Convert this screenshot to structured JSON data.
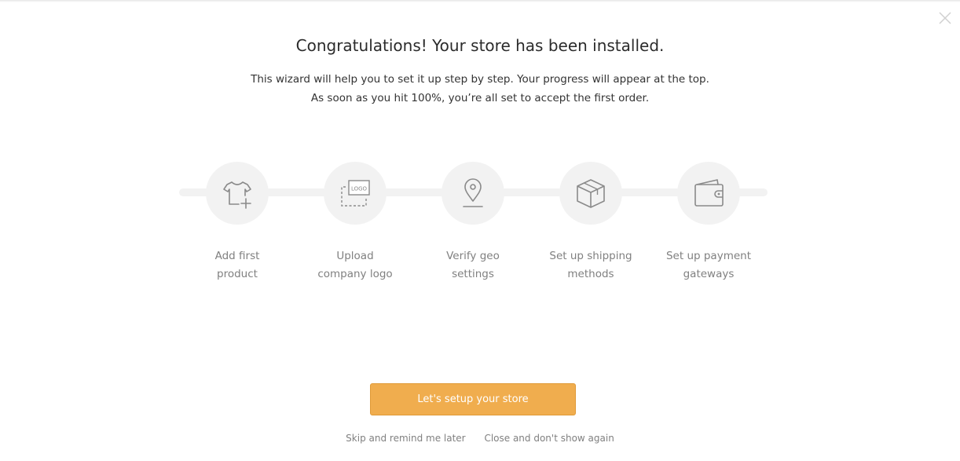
{
  "header": {
    "title": "Congratulations! Your store has been installed.",
    "subtitle_line1": "This wizard will help you to set it up step by step. Your progress will appear at the top.",
    "subtitle_line2": "As soon as you hit 100%, you’re all set to accept the first order."
  },
  "steps": [
    {
      "label": "Add first\nproduct",
      "icon": "tshirt-plus-icon"
    },
    {
      "label": "Upload\ncompany logo",
      "icon": "logo-upload-icon",
      "logo_text": "LOGO"
    },
    {
      "label": "Verify geo\nsettings",
      "icon": "map-pin-icon"
    },
    {
      "label": "Set up shipping\nmethods",
      "icon": "box-icon"
    },
    {
      "label": "Set up payment\ngateways",
      "icon": "wallet-icon"
    }
  ],
  "actions": {
    "primary_label": "Let's setup your store",
    "skip_label": "Skip and remind me later",
    "dismiss_label": "Close and don't show again"
  },
  "colors": {
    "accent": "#f0ad4e",
    "muted_text": "#808080",
    "step_bg": "#f2f2f2",
    "icon_stroke": "#8a8a8a"
  }
}
